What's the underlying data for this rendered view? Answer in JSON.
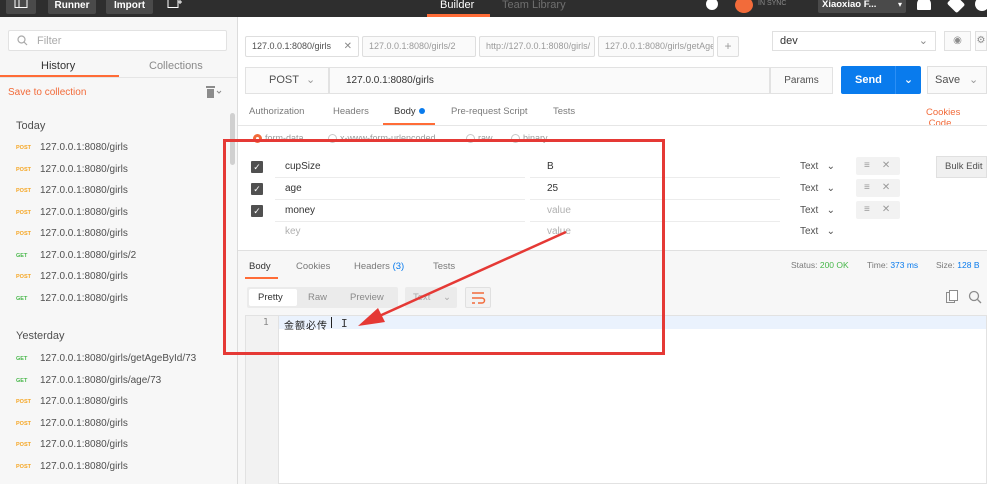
{
  "topbar": {
    "runner_label": "Runner",
    "import_label": "Import",
    "builder_tab": "Builder",
    "team_library_tab": "Team Library",
    "sync_status": "IN SYNC",
    "user_name": "Xiaoxiao F..."
  },
  "sidebar": {
    "filter_placeholder": "Filter",
    "history_tab": "History",
    "collections_tab": "Collections",
    "save_to_collection": "Save to collection",
    "today_label": "Today",
    "yesterday_label": "Yesterday",
    "today_items": [
      {
        "method": "POST",
        "url": "127.0.0.1:8080/girls"
      },
      {
        "method": "POST",
        "url": "127.0.0.1:8080/girls"
      },
      {
        "method": "POST",
        "url": "127.0.0.1:8080/girls"
      },
      {
        "method": "POST",
        "url": "127.0.0.1:8080/girls"
      },
      {
        "method": "POST",
        "url": "127.0.0.1:8080/girls"
      },
      {
        "method": "GET",
        "url": "127.0.0.1:8080/girls/2"
      },
      {
        "method": "POST",
        "url": "127.0.0.1:8080/girls"
      },
      {
        "method": "GET",
        "url": "127.0.0.1:8080/girls"
      }
    ],
    "yesterday_items": [
      {
        "method": "GET",
        "url": "127.0.0.1:8080/girls/getAgeById/73"
      },
      {
        "method": "GET",
        "url": "127.0.0.1:8080/girls/age/73"
      },
      {
        "method": "POST",
        "url": "127.0.0.1:8080/girls"
      },
      {
        "method": "POST",
        "url": "127.0.0.1:8080/girls"
      },
      {
        "method": "POST",
        "url": "127.0.0.1:8080/girls"
      },
      {
        "method": "POST",
        "url": "127.0.0.1:8080/girls"
      }
    ]
  },
  "tabs": [
    {
      "label": "127.0.0.1:8080/girls"
    },
    {
      "label": "127.0.0.1:8080/girls/2"
    },
    {
      "label": "http://127.0.0.1:8080/girls/"
    },
    {
      "label": "127.0.0.1:8080/girls/getAge"
    }
  ],
  "environment": "dev",
  "request": {
    "method": "POST",
    "url": "127.0.0.1:8080/girls",
    "params_label": "Params",
    "send_label": "Send",
    "save_label": "Save"
  },
  "subtabs": {
    "authorization": "Authorization",
    "headers": "Headers",
    "body": "Body",
    "prerequest": "Pre-request Script",
    "tests": "Tests",
    "cookies": "Cookies",
    "code": "Code"
  },
  "body_types": {
    "form_data": "form-data",
    "urlencoded": "x-www-form-urlencoded",
    "raw": "raw",
    "binary": "binary"
  },
  "form_rows": [
    {
      "key": "cupSize",
      "value": "B",
      "type": "Text"
    },
    {
      "key": "age",
      "value": "25",
      "type": "Text"
    },
    {
      "key": "money",
      "value": "value",
      "type": "Text"
    },
    {
      "key": "key",
      "value": "value",
      "type": "Text"
    }
  ],
  "bulk_edit_label": "Bulk Edit",
  "response": {
    "tabs": {
      "body": "Body",
      "cookies": "Cookies",
      "headers": "Headers",
      "headers_count": "(3)",
      "tests": "Tests"
    },
    "status_label": "Status:",
    "status_value": "200 OK",
    "time_label": "Time:",
    "time_value": "373 ms",
    "size_label": "Size:",
    "size_value": "128 B",
    "view_tabs": {
      "pretty": "Pretty",
      "raw": "Raw",
      "preview": "Preview"
    },
    "format": "Text",
    "line_number": "1",
    "content": "金额必传"
  },
  "colors": {
    "accent": "#ff6c37",
    "send": "#097bed",
    "annotation": "#e53935",
    "post": "#f5a623",
    "get": "#47b749"
  }
}
